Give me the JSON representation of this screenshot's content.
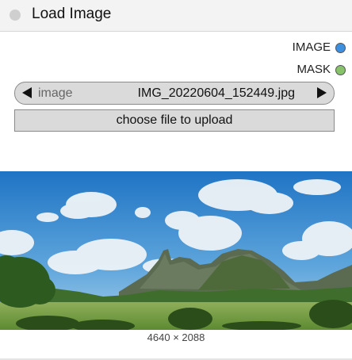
{
  "node": {
    "title": "Load Image"
  },
  "outputs": [
    {
      "label": "IMAGE",
      "color": "#3d8fe0"
    },
    {
      "label": "MASK",
      "color": "#86c36a"
    }
  ],
  "image_widget": {
    "name": "image",
    "value": "IMG_20220604_152449.jpg"
  },
  "upload_button": {
    "label": "choose file to upload"
  },
  "preview": {
    "description_icon": "landscape-photo",
    "dimensions": "4640 × 2088"
  }
}
